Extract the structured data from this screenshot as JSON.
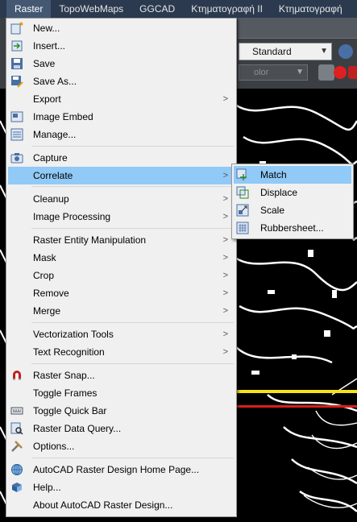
{
  "menubar": {
    "items": [
      "Raster",
      "TopoWebMaps",
      "GGCAD",
      "Κτηματογραφή ΙΙ",
      "Κτηματογραφή"
    ]
  },
  "toolbar": {
    "style_combo": "Standard",
    "layer_combo": "olor"
  },
  "menu": {
    "items": [
      {
        "label": "New...",
        "icon": "new-image-icon"
      },
      {
        "label": "Insert...",
        "icon": "insert-image-icon"
      },
      {
        "label": "Save",
        "icon": "save-icon"
      },
      {
        "label": "Save As...",
        "icon": "save-as-icon"
      },
      {
        "label": "Export",
        "icon": "",
        "submenu": true
      },
      {
        "label": "Image Embed",
        "icon": "image-embed-icon"
      },
      {
        "label": "Manage...",
        "icon": "manage-icon"
      },
      {
        "label": "Capture",
        "icon": "capture-icon"
      },
      {
        "label": "Correlate",
        "icon": "",
        "submenu": true
      },
      {
        "label": "Cleanup",
        "icon": "",
        "submenu": true
      },
      {
        "label": "Image Processing",
        "icon": "",
        "submenu": true
      },
      {
        "label": "Raster Entity Manipulation",
        "icon": "",
        "submenu": true
      },
      {
        "label": "Mask",
        "icon": "",
        "submenu": true
      },
      {
        "label": "Crop",
        "icon": "",
        "submenu": true
      },
      {
        "label": "Remove",
        "icon": "",
        "submenu": true
      },
      {
        "label": "Merge",
        "icon": "",
        "submenu": true
      },
      {
        "label": "Vectorization Tools",
        "icon": "",
        "submenu": true
      },
      {
        "label": "Text Recognition",
        "icon": "",
        "submenu": true
      },
      {
        "label": "Raster Snap...",
        "icon": "magnet-icon"
      },
      {
        "label": "Toggle Frames",
        "icon": ""
      },
      {
        "label": "Toggle Quick Bar",
        "icon": "quick-bar-icon"
      },
      {
        "label": "Raster Data Query...",
        "icon": "data-query-icon"
      },
      {
        "label": "Options...",
        "icon": "options-icon"
      },
      {
        "label": "AutoCAD Raster Design Home Page...",
        "icon": "globe-icon"
      },
      {
        "label": "Help...",
        "icon": "help-book-icon"
      },
      {
        "label": "About AutoCAD Raster Design...",
        "icon": ""
      }
    ]
  },
  "submenu": {
    "items": [
      {
        "label": "Match",
        "icon": "match-icon"
      },
      {
        "label": "Displace",
        "icon": "displace-icon"
      },
      {
        "label": "Scale",
        "icon": "scale-icon"
      },
      {
        "label": "Rubbersheet...",
        "icon": "rubbersheet-icon"
      }
    ]
  }
}
